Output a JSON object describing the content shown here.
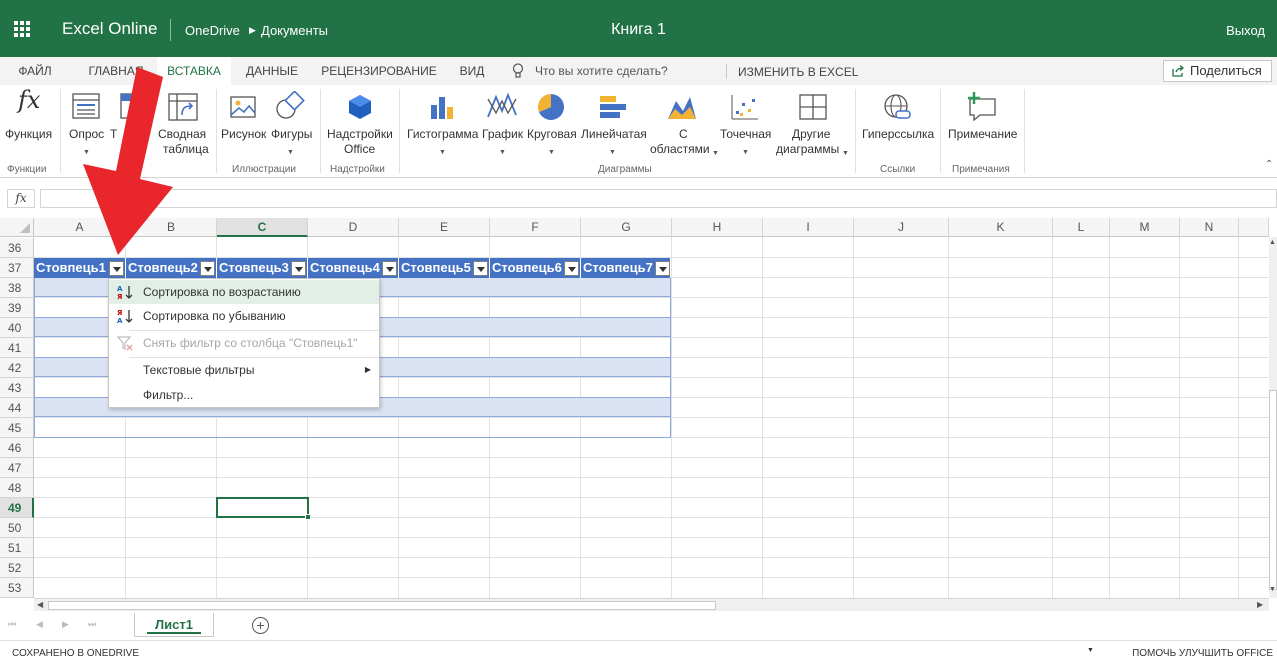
{
  "titlebar": {
    "app_name": "Excel Online",
    "breadcrumb_root": "OneDrive",
    "breadcrumb_folder": "Документы",
    "doc_title": "Книга 1",
    "exit": "Выход",
    "bg_color": "#217346"
  },
  "tabs": [
    {
      "label": "ФАЙЛ",
      "active": false
    },
    {
      "label": "ГЛАВНАЯ",
      "active": false
    },
    {
      "label": "ВСТАВКА",
      "active": true
    },
    {
      "label": "ДАННЫЕ",
      "active": false
    },
    {
      "label": "РЕЦЕНЗИРОВАНИЕ",
      "active": false
    },
    {
      "label": "ВИД",
      "active": false
    }
  ],
  "tell_me": "Что вы хотите сделать?",
  "edit_in_excel": "ИЗМЕНИТЬ В EXCEL",
  "share": "Поделиться",
  "ribbon": {
    "function": "Функция",
    "survey": "Опрос",
    "table": "Т",
    "pivot_line1": "Сводная",
    "pivot_line2": "таблица",
    "picture": "Рисунок",
    "shapes": "Фигуры",
    "addins_line1": "Надстройки",
    "addins_line2": "Office",
    "histogram": "Гистограмма",
    "graph": "График",
    "pie": "Круговая",
    "linear": "Линейчатая",
    "area_line1": "С",
    "area_line2": "областями",
    "scatter": "Точечная",
    "other_line1": "Другие",
    "other_line2": "диаграммы",
    "hyperlink": "Гиперссылка",
    "comment": "Примечание",
    "groups": {
      "functions": "Функции",
      "illustrations": "Иллюстрации",
      "addins": "Надстройки",
      "charts": "Диаграммы",
      "links": "Ссылки",
      "comments": "Примечания"
    }
  },
  "formula_icon": "fx",
  "columns": [
    "A",
    "B",
    "C",
    "D",
    "E",
    "F",
    "G",
    "H",
    "I",
    "J",
    "K",
    "L",
    "M",
    "N"
  ],
  "active_column": "C",
  "rows": [
    "36",
    "37",
    "38",
    "39",
    "40",
    "41",
    "42",
    "43",
    "44",
    "45",
    "46",
    "47",
    "48",
    "49",
    "50",
    "51",
    "52",
    "53"
  ],
  "active_row": "49",
  "table_headers": [
    "Стовпець1",
    "Стовпець2",
    "Стовпець3",
    "Стовпець4",
    "Стовпець5",
    "Стовпець6",
    "Стовпець7"
  ],
  "table_header_color": "#4472c4",
  "table_band_color": "#dae3f3",
  "menu": {
    "sort_asc": "Сортировка по возрастанию",
    "sort_desc": "Сортировка по убыванию",
    "clear_filter": "Снять фильтр со столбца \"Стовпець1\"",
    "text_filters": "Текстовые фильтры",
    "filter": "Фильтр..."
  },
  "sheet_tab": "Лист1",
  "status": {
    "left": "СОХРАНЕНО В ONEDRIVE",
    "right": "ПОМОЧЬ УЛУЧШИТЬ OFFICE"
  },
  "annotation_arrow_color": "#e8262b"
}
